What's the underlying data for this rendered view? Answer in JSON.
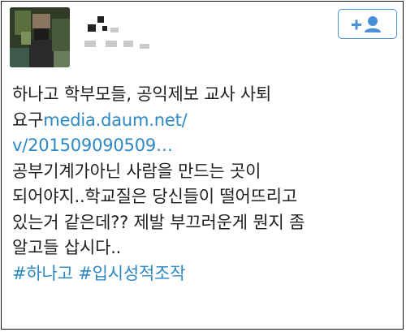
{
  "header": {
    "follow_icon": "add-user-icon",
    "accent_color": "#4a90d9"
  },
  "tweet": {
    "line1": "하나고 학부모들, 공익제보 교사 사퇴",
    "line2_text": "요구",
    "line2_link": "media.daum.net/",
    "line3_link": "v/201509090509…",
    "line4": "공부기계가아닌 사람을 만드는 곳이",
    "line5": "되어야지..학교질은 당신들이 떨어뜨리고",
    "line6": "있는거 같은데?? 제발 부끄러운게 뭔지 좀",
    "line7": "알고들 삽시다..",
    "hashtags": [
      "#하나고",
      "#입시성적조작"
    ]
  },
  "colors": {
    "text": "#1f1f1f",
    "link": "#2d89c4"
  }
}
